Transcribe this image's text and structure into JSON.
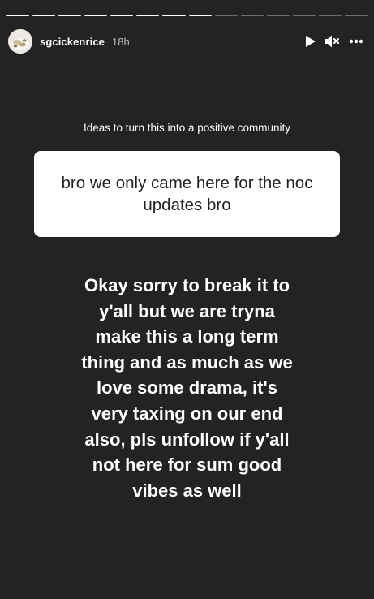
{
  "progress": {
    "total_segments": 14,
    "completed_segments": 8
  },
  "header": {
    "username": "sgcickenrice",
    "time_ago": "18h"
  },
  "icons": {
    "play": "play-icon",
    "mute": "speaker-muted-icon",
    "more": "more-options-icon"
  },
  "question_sticker": {
    "prompt": "Ideas to turn this into a positive community",
    "answer": "bro we only came here for the noc updates bro"
  },
  "story_text": "Okay sorry to break it to\ny'all but we are tryna\nmake this a long term\nthing and as much as we\nlove some drama, it's\nvery taxing on our end\nalso, pls unfollow if y'all\nnot here for sum good\nvibes as well",
  "colors": {
    "background": "#232323",
    "card": "#ffffff",
    "text": "#ffffff"
  }
}
